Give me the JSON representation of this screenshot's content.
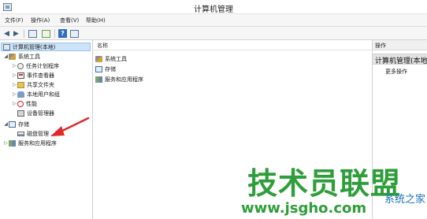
{
  "window": {
    "title": "计算机管理"
  },
  "menu": [
    {
      "label": "文件(F)"
    },
    {
      "label": "操作(A)"
    },
    {
      "label": "查看(V)"
    },
    {
      "label": "帮助(H)"
    }
  ],
  "toolbar": {
    "back_icon": "back-arrow-icon",
    "forward_icon": "forward-arrow-icon",
    "buttons": [
      "show-hide-tree-icon",
      "export-list-icon",
      "help-icon",
      "properties-icon"
    ],
    "help_glyph": "?"
  },
  "tree": {
    "root": "计算机管理(本地)",
    "system_tools": "系统工具",
    "system_tools_children": [
      {
        "label": "任务计划程序",
        "icon": "task-scheduler-icon"
      },
      {
        "label": "事件查看器",
        "icon": "event-viewer-icon"
      },
      {
        "label": "共享文件夹",
        "icon": "shared-folders-icon"
      },
      {
        "label": "本地用户和组",
        "icon": "local-users-icon"
      },
      {
        "label": "性能",
        "icon": "performance-icon"
      },
      {
        "label": "设备管理器",
        "icon": "device-manager-icon"
      }
    ],
    "storage": "存储",
    "disk_management": "磁盘管理",
    "services": "服务和应用程序"
  },
  "main": {
    "column_header": "名称",
    "items": [
      {
        "label": "系统工具",
        "icon": "tools-icon"
      },
      {
        "label": "存储",
        "icon": "storage-icon"
      },
      {
        "label": "服务和应用程序",
        "icon": "services-icon"
      }
    ]
  },
  "actions": {
    "header": "操作",
    "title": "计算机管理(本地)",
    "more": "更多操作"
  },
  "watermark": {
    "main": "技术员联盟",
    "sub": "系统之家",
    "url": "www.jsgho.com"
  },
  "colors": {
    "selection": "#cde3f7",
    "annotation_arrow": "#e02a2a",
    "watermark_green": "#2e9e3a",
    "watermark_blue": "#1b6fb8"
  }
}
